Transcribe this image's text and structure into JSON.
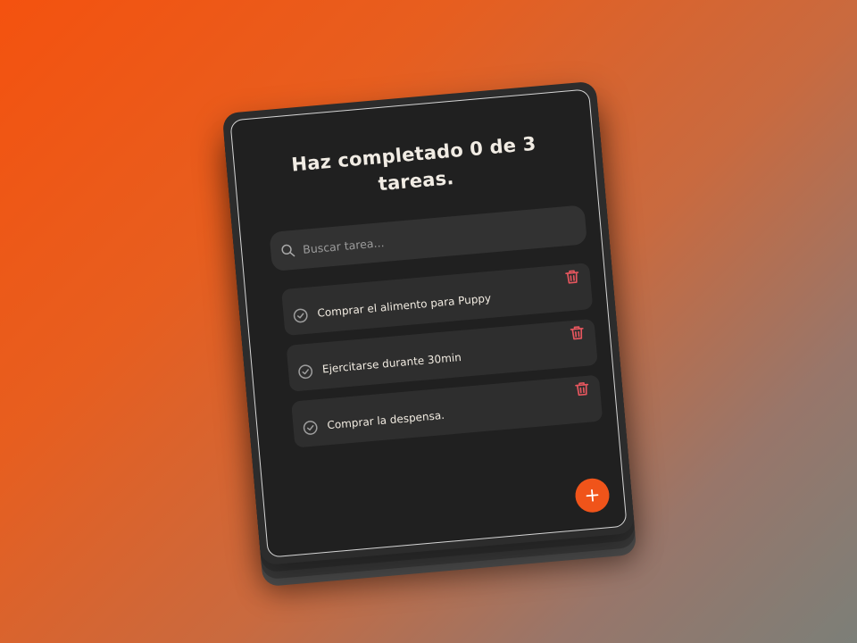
{
  "header": {
    "title": "Haz completado 0 de 3 tareas."
  },
  "search": {
    "placeholder": "Buscar tarea...",
    "value": "",
    "icon": "search-icon"
  },
  "tasks": [
    {
      "label": "Comprar el alimento para Puppy",
      "completed": false
    },
    {
      "label": "Ejercitarse durante 30min",
      "completed": false
    },
    {
      "label": "Comprar la despensa.",
      "completed": false
    }
  ],
  "icons": {
    "check": "check-circle-icon",
    "delete": "trash-icon",
    "add": "plus-icon"
  },
  "colors": {
    "accent": "#f0541a",
    "delete": "#e6565e",
    "card": "#202020",
    "task_bg": "#2e2e2e",
    "text": "#f2ece2",
    "check": "#9e9e9e"
  }
}
